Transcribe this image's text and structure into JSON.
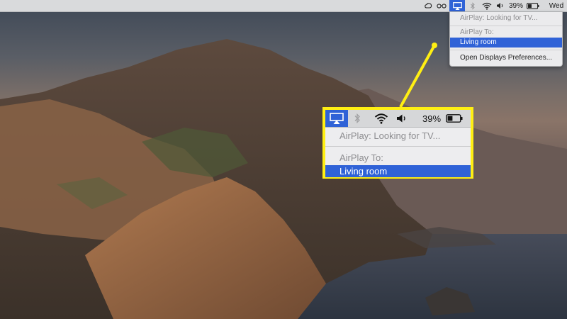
{
  "menubar": {
    "battery_percent": "39%",
    "day": "Wed"
  },
  "airplay_menu": {
    "status": "AirPlay: Looking for TV...",
    "airplay_to_header": "AirPlay To:",
    "selected_device": "Living room",
    "open_prefs": "Open Displays Preferences..."
  },
  "callout": {
    "battery_percent": "39%",
    "status": "AirPlay: Looking for TV...",
    "airplay_to_header": "AirPlay To:",
    "selected_device": "Living room"
  },
  "colors": {
    "highlight": "#2f62d7",
    "callout_border": "#ffef13"
  },
  "icons": [
    "creative-cloud-icon",
    "glasses-icon",
    "airplay-icon",
    "bluetooth-icon",
    "wifi-icon",
    "volume-icon",
    "battery-icon"
  ]
}
